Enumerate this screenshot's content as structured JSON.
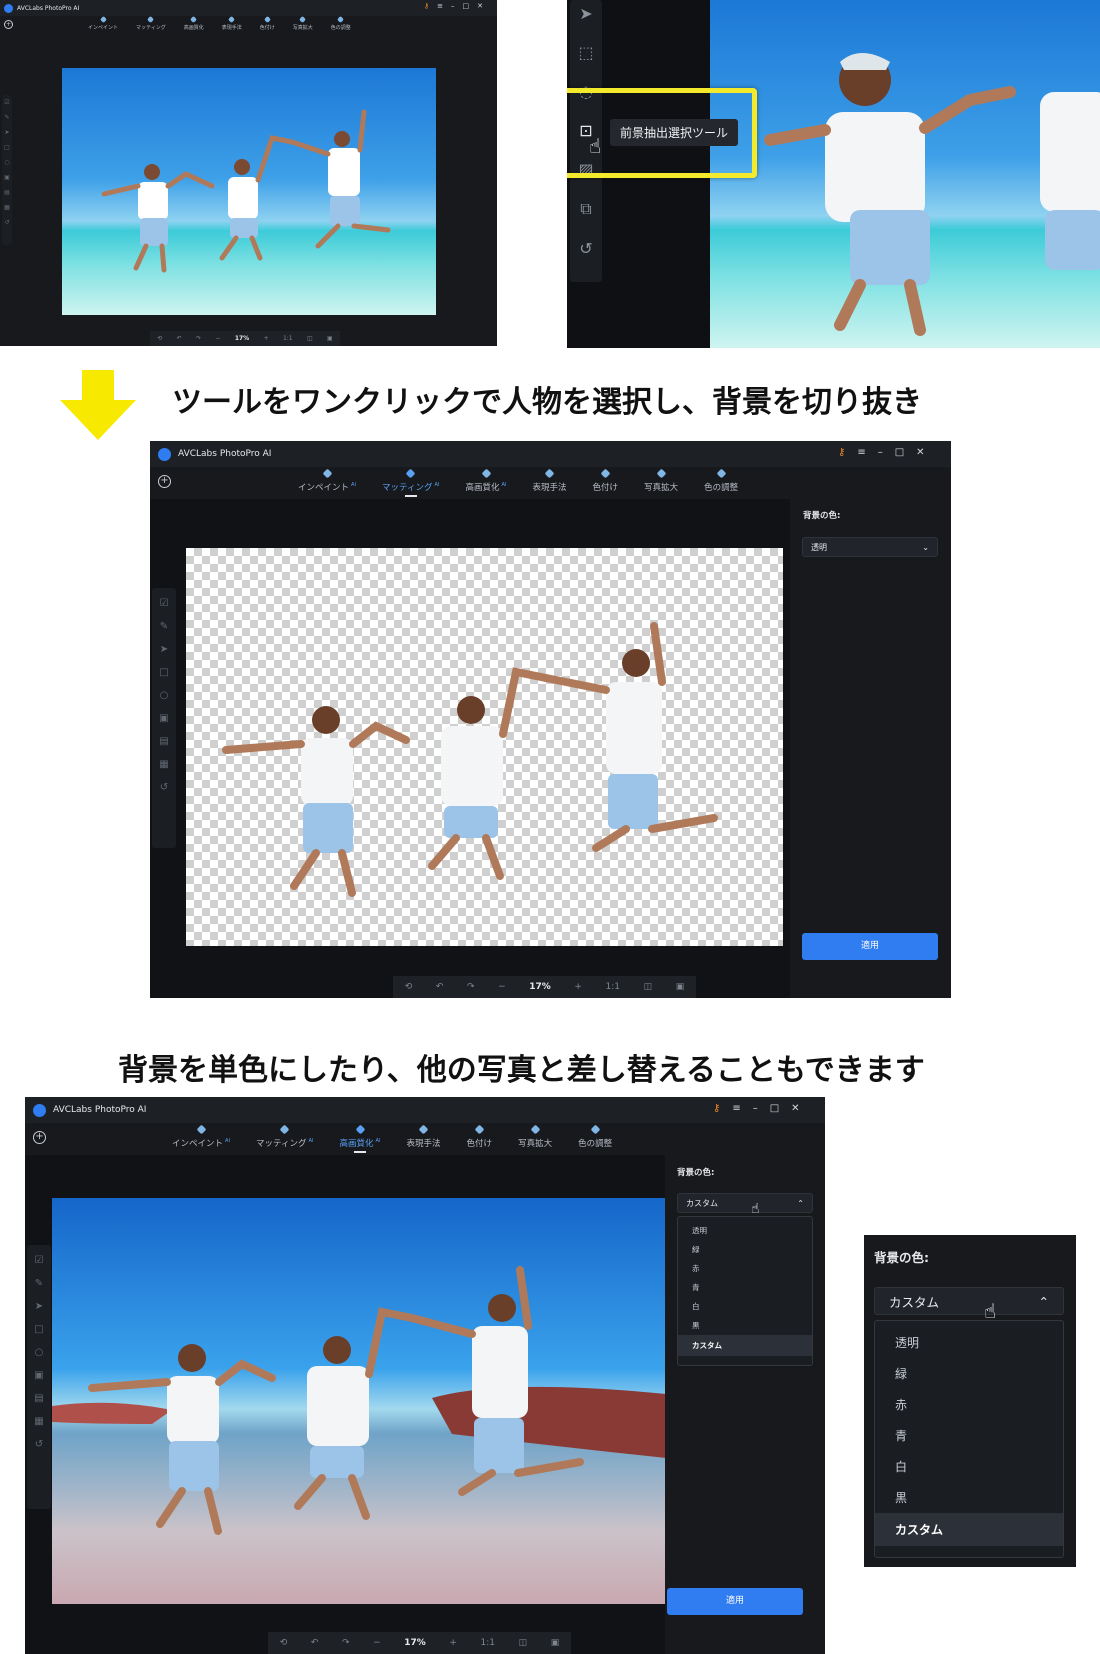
{
  "app": {
    "title": "AVCLabs PhotoPro AI",
    "tools": [
      {
        "label": "インペイント",
        "ai": "AI"
      },
      {
        "label": "マッティング",
        "ai": "AI"
      },
      {
        "label": "高画質化",
        "ai": "AI"
      },
      {
        "label": "表現手法",
        "ai": ""
      },
      {
        "label": "色付け",
        "ai": ""
      },
      {
        "label": "写真拡大",
        "ai": ""
      },
      {
        "label": "色の調整",
        "ai": ""
      }
    ],
    "zoom": "17%",
    "ratio": "1:1"
  },
  "tooltip": {
    "text": "前景抽出選択ツール"
  },
  "captions": {
    "first": "ツールをワンクリックで人物を選択し、背景を切り抜き",
    "second": "背景を単色にしたり、他の写真と差し替えることもできます"
  },
  "panel": {
    "bg_label": "背景の色:",
    "transparent_value": "透明",
    "custom_value": "カスタム",
    "apply": "適用",
    "options": [
      "透明",
      "緑",
      "赤",
      "青",
      "白",
      "黒",
      "カスタム"
    ],
    "selected_option": "カスタム"
  },
  "colors": {
    "accent": "#2f7df0",
    "highlight": "#f2ea2a",
    "key": "#f08a24",
    "app_bg": "#17191d"
  }
}
